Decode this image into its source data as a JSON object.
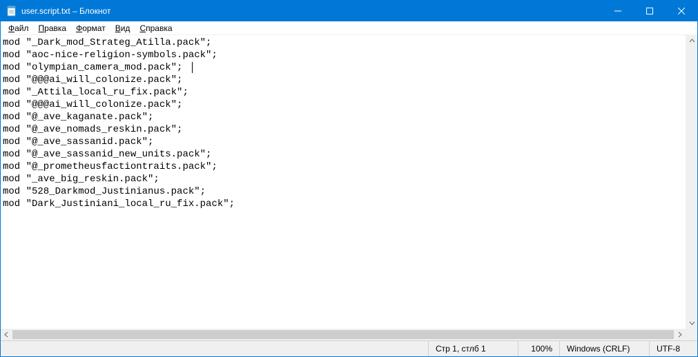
{
  "title": "user.script.txt – Блокнот",
  "menu": {
    "file": {
      "label": "Файл",
      "ul": "Ф",
      "rest": "айл"
    },
    "edit": {
      "label": "Правка",
      "ul": "П",
      "rest": "равка"
    },
    "format": {
      "label": "Формат",
      "ul": "Ф",
      "rest": "ормат"
    },
    "view": {
      "label": "Вид",
      "ul": "В",
      "rest": "ид"
    },
    "help": {
      "label": "Справка",
      "ul": "С",
      "rest": "правка"
    }
  },
  "content_lines": [
    "mod \"_Dark_mod_Strateg_Atilla.pack\";",
    "mod \"aoc-nice-religion-symbols.pack\";",
    "mod \"olympian_camera_mod.pack\";",
    "mod \"@@@ai_will_colonize.pack\";",
    "mod \"_Attila_local_ru_fix.pack\";",
    "mod \"@@@ai_will_colonize.pack\";",
    "mod \"@_ave_kaganate.pack\";",
    "mod \"@_ave_nomads_reskin.pack\";",
    "mod \"@_ave_sassanid.pack\";",
    "mod \"@_ave_sassanid_new_units.pack\";",
    "mod \"@_prometheusfactiontraits.pack\";",
    "mod \"_ave_big_reskin.pack\";",
    "mod \"528_Darkmod_Justinianus.pack\";",
    "mod \"Dark_Justiniani_local_ru_fix.pack\";"
  ],
  "caret_after_line_index": 2,
  "status": {
    "position": "Стр 1, стлб 1",
    "zoom": "100%",
    "line_ending": "Windows (CRLF)",
    "encoding": "UTF-8"
  }
}
